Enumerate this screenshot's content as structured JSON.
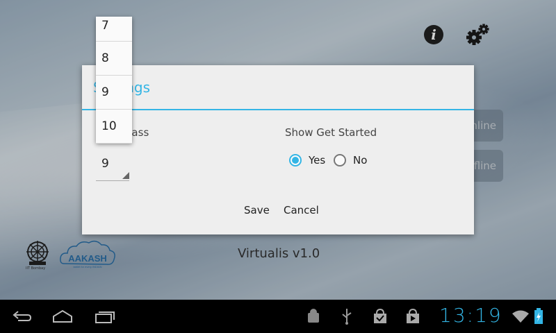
{
  "dialog": {
    "title": "Settings",
    "class_label": "Your Class",
    "class_value": "9",
    "get_started_label": "Show Get Started",
    "radio_yes": "Yes",
    "radio_no": "No",
    "selected": "Yes",
    "save_label": "Save",
    "cancel_label": "Cancel"
  },
  "dropdown": {
    "options": [
      "7",
      "8",
      "9",
      "10"
    ]
  },
  "background": {
    "button_online": "Online",
    "button_offline": "Offline"
  },
  "home": {
    "version": "Virtualis v1.0",
    "iit_caption": "IIT Bombay",
    "aakash_text": "AAKASH",
    "aakash_tagline": "tablet for every INDIAN"
  },
  "statusbar": {
    "time": "13:19"
  },
  "colors": {
    "accent": "#33b5e5"
  },
  "icons": [
    "info-icon",
    "settings-gear-icon",
    "back-icon",
    "home-icon",
    "recent-apps-icon",
    "android-debug-icon",
    "usb-icon",
    "market-icon",
    "play-store-icon",
    "wifi-icon",
    "battery-icon"
  ]
}
